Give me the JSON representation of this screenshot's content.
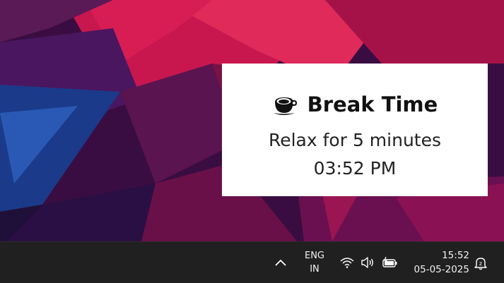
{
  "toast": {
    "icon": "coffee-cup-icon",
    "title": "Break Time",
    "message": "Relax for 5 minutes",
    "time": "03:52 PM"
  },
  "taskbar": {
    "overflow_icon": "chevron-up-icon",
    "language": {
      "line1": "ENG",
      "line2": "IN"
    },
    "wifi_icon": "wifi-icon",
    "volume_icon": "speaker-icon",
    "battery_icon": "battery-charging-icon",
    "clock": {
      "time": "15:52",
      "date": "05-05-2025"
    },
    "notification_icon": "notification-bell-icon"
  },
  "colors": {
    "taskbar_bg": "#202020",
    "toast_bg": "#ffffff",
    "wallpaper_accent": "#c8174f"
  }
}
